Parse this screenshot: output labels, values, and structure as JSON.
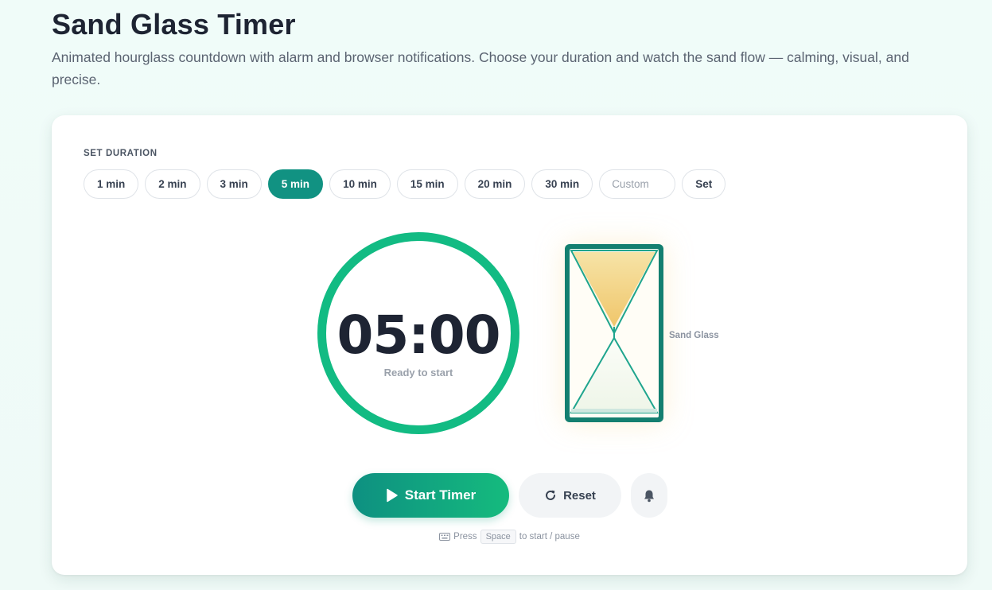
{
  "header": {
    "title": "Sand Glass Timer",
    "subtitle": "Animated hourglass countdown with alarm and browser notifications. Choose your duration and watch the sand flow — calming, visual, and precise."
  },
  "duration": {
    "section_label": "SET DURATION",
    "presets": [
      "1 min",
      "2 min",
      "3 min",
      "5 min",
      "10 min",
      "15 min",
      "20 min",
      "30 min"
    ],
    "active_preset": "5 min",
    "custom_placeholder": "Custom",
    "custom_value": "",
    "set_label": "Set"
  },
  "timer": {
    "time": "05:00",
    "status": "Ready to start",
    "progress": 1.0
  },
  "hourglass": {
    "label": "Sand Glass",
    "sand_top_fraction": 1.0
  },
  "controls": {
    "start_label": "Start Timer",
    "reset_label": "Reset",
    "start_icon": "play-icon",
    "reset_icon": "rotate-icon",
    "alarm_icon": "bell-icon"
  },
  "hint": {
    "prefix": "Press",
    "key": "Space",
    "suffix": "to start / pause",
    "icon": "keyboard-icon"
  },
  "colors": {
    "accent": "#119282",
    "ring": "#12bb83",
    "sand": "#f3d07f",
    "frame": "#137f70"
  }
}
